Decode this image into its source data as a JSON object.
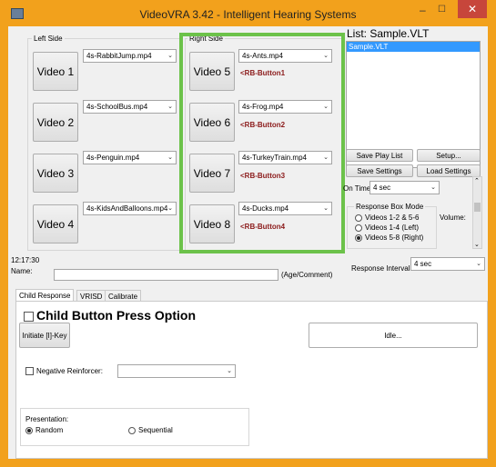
{
  "window": {
    "title": "VideoVRA 3.42 - Intelligent Hearing Systems",
    "minimize": "–",
    "maximize": "☐",
    "close": "✕"
  },
  "left_side": {
    "label": "Left Side",
    "rows": [
      {
        "button": "Video 1",
        "file": "4s-RabbitJump.mp4"
      },
      {
        "button": "Video 2",
        "file": "4s-SchoolBus.mp4"
      },
      {
        "button": "Video 3",
        "file": "4s-Penguin.mp4"
      },
      {
        "button": "Video 4",
        "file": "4s-KidsAndBalloons.mp4"
      }
    ]
  },
  "right_side": {
    "label": "Right Side",
    "rows": [
      {
        "button": "Video 5",
        "file": "4s-Ants.mp4",
        "rb": "<RB-Button1"
      },
      {
        "button": "Video 6",
        "file": "4s-Frog.mp4",
        "rb": "<RB-Button2"
      },
      {
        "button": "Video 7",
        "file": "4s-TurkeyTrain.mp4",
        "rb": "<RB-Button3"
      },
      {
        "button": "Video 8",
        "file": "4s-Ducks.mp4",
        "rb": "<RB-Button4"
      }
    ]
  },
  "list": {
    "title": "List: Sample.VLT",
    "items": [
      "Sample.VLT"
    ]
  },
  "buttons": {
    "save_play_list": "Save Play List",
    "setup": "Setup...",
    "save_settings": "Save Settings",
    "load_settings": "Load Settings"
  },
  "on_time": {
    "label": "On Time:",
    "value": "4 sec"
  },
  "response_box": {
    "label": "Response Box Mode",
    "options": [
      "Videos 1-2 & 5-6",
      "Videos 1-4 (Left)",
      "Videos 5-8 (Right)"
    ],
    "selected": 2
  },
  "volume_label": "Volume:",
  "clock": "12:17:30",
  "name": {
    "label": "Name:",
    "value": "",
    "hint": "(Age/Comment)"
  },
  "response_interval": {
    "label": "Response Interval:",
    "value": "4 sec"
  },
  "tabs": [
    "Child Response",
    "VRISD",
    "Calibrate"
  ],
  "active_tab": 0,
  "child": {
    "heading": "Child Button Press Option",
    "initiate": "Initiate [I]-Key",
    "idle": "Idle...",
    "neg_reinforcer": "Negative Reinforcer:",
    "neg_value": "",
    "presentation_label": "Presentation:",
    "presentation_options": [
      "Random",
      "Sequential"
    ],
    "presentation_selected": 0
  },
  "colors": {
    "frame": "#f2a11c",
    "highlight": "#6cc24a",
    "rb_text": "#8b1a1a",
    "selection": "#3399ff"
  }
}
